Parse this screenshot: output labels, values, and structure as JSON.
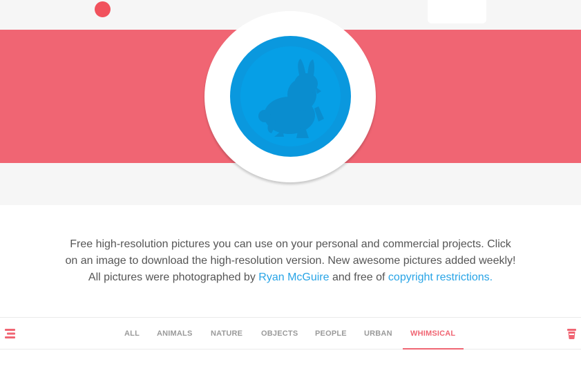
{
  "intro": {
    "line1": "Free high-resolution pictures you can use on your personal and commercial projects. Click",
    "line2": "on an image to download the high-resolution version. New awesome pictures added weekly!",
    "line3_prefix": "All pictures were photographed by ",
    "author_link": "Ryan McGuire",
    "line3_middle": " and free of ",
    "restrictions_link": "copyright restrictions."
  },
  "nav": {
    "left_icon": "menu-icon",
    "right_icon": "cup-icon",
    "active_tab": "WHIMSICAL",
    "tabs": [
      "ALL",
      "ANIMALS",
      "NATURE",
      "OBJECTS",
      "PEOPLE",
      "URBAN",
      "WHIMSICAL"
    ]
  },
  "colors": {
    "accent": "#f06573",
    "notification_dot": "#f1525d",
    "logo_blue": "#0a98de",
    "link": "#28a4e6"
  }
}
